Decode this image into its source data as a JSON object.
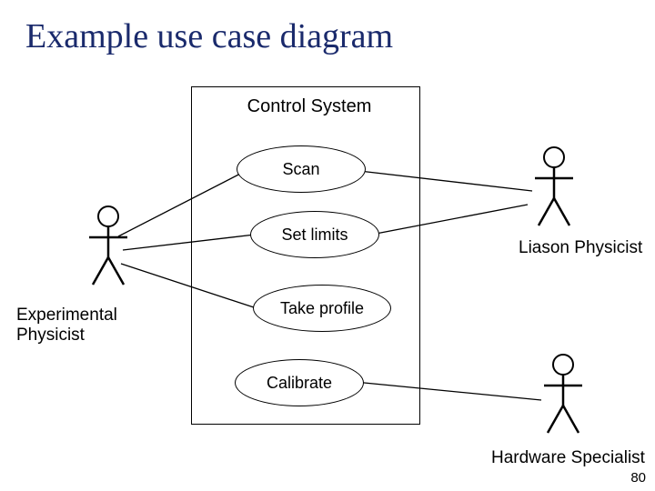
{
  "title": "Example use case diagram",
  "system_name": "Control System",
  "usecases": {
    "scan": "Scan",
    "set_limits": "Set limits",
    "take_profile": "Take profile",
    "calibrate": "Calibrate"
  },
  "actors": {
    "experimental": "Experimental\nPhysicist",
    "liason": "Liason Physicist",
    "hardware": "Hardware Specialist"
  },
  "page": "80"
}
